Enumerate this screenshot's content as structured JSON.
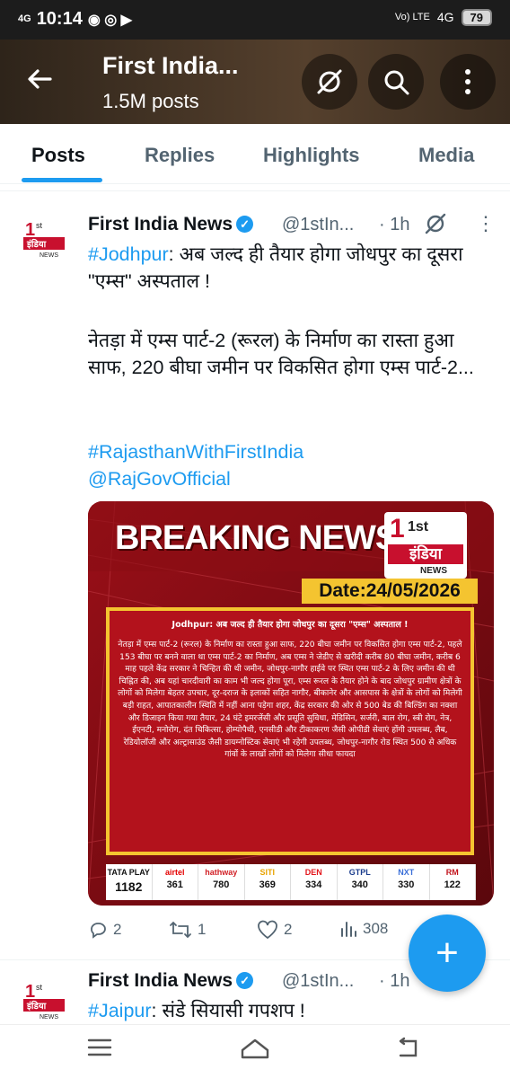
{
  "status_bar": {
    "net_left": "4G",
    "time": "10:14",
    "volte": "Vo) LTE",
    "net_right": "4G",
    "battery": "79"
  },
  "appbar": {
    "title": "First India...",
    "subtitle": "1.5M posts"
  },
  "tabs": [
    "Posts",
    "Replies",
    "Highlights",
    "Media"
  ],
  "post1": {
    "name": "First India News",
    "handle": "@1stIn...",
    "time": "· 1h",
    "line1_tag": "#Jodhpur",
    "line1_rest": ": अब जल्द ही तैयार होगा जोधपुर का दूसरा \"एम्स\" अस्पताल !",
    "para2": "नेतड़ा में एम्स पार्ट-2 (रूरल) के निर्माण का रास्ता हुआ साफ, 220 बीघा जमीन पर विकसित होगा एम्स पार्ट-2...",
    "hashtag": "#RajasthanWithFirstIndia",
    "mention": "@RajGovOfficial",
    "image": {
      "banner": "BREAKING NEWS",
      "logo_top": "1st",
      "logo_main": "इंडिया",
      "logo_sub": "NEWS",
      "date": "Date:24/05/2026",
      "headline": "Jodhpur: अब जल्द ही तैयार होगा जोधपुर का दूसरा \"एम्स\" अस्पताल !",
      "body": "नेतड़ा में एम्स पार्ट-2 (रूरल) के निर्माण का रास्ता हुआ साफ, 220 बीघा जमीन पर विकसित होगा एम्स पार्ट-2, पहले 153 बीघा पर बनने वाला था एम्स पार्ट-2 का निर्माण, अब एम्स ने जेडीए से खरीदी करीब 80 बीघा जमीन, करीब 6 माह पहले केंद्र सरकार ने चिन्हित की थी जमीन, जोधपुर-नागौर हाईवे पर स्थित एम्स पार्ट-2 के लिए जमीन की थी चिह्नित की, अब यहां चारदीवारी का काम भी जल्द होगा पूरा, एम्स रूरल के तैयार होने के बाद जोधपुर ग्रामीण क्षेत्रों के लोगों को मिलेगा बेहतर उपचार, दूर-दराज के इलाकों सहित नागौर, बीकानेर और आसपास के क्षेत्रों के लोगों को मिलेगी बड़ी राहत, आपातकालीन स्थिति में नहीं आना पड़ेगा शहर, केंद्र सरकार की ओर से 500 बेड की बिल्डिंग का नक्शा और डिजाइन किया गया तैयार, 24 घंटे इमरजेंसी और प्रसूति सुविधा, मेडिसिन, सर्जरी, बाल रोग, स्त्री रोग, नेत्र, ईएनटी, मनोरोग, दंत चिकित्सा, होम्योपैथी, एनसीडी और टीकाकरण जैसी ओपीडी सेवाएं होंगी उपलब्ध, लैब, रेडियोलॉजी और अल्ट्रासाउंड जैसी डायग्नोस्टिक सेवाएं भी रहेगी उपलब्ध, जोधपुर-नागौर रोड स्थित 500 से अधिक गांवों के लाखों लोगों को मिलेगा सीधा फायदा",
      "channels": [
        {
          "name": "TATA PLAY",
          "num": "1182",
          "color": "#111111"
        },
        {
          "name": "airtel",
          "num": "361",
          "color": "#e40000"
        },
        {
          "name": "hathway",
          "num": "780",
          "color": "#d11e24"
        },
        {
          "name": "SITI",
          "num": "369",
          "color": "#e8a300"
        },
        {
          "name": "DEN",
          "num": "334",
          "color": "#e3161c"
        },
        {
          "name": "GTPL",
          "num": "340",
          "color": "#1a3c8c"
        },
        {
          "name": "NXT",
          "num": "330",
          "color": "#3a6fd8"
        },
        {
          "name": "RM",
          "num": "122",
          "color": "#c2121a"
        }
      ]
    },
    "actions": {
      "replies": "2",
      "reposts": "1",
      "likes": "2",
      "views": "308"
    }
  },
  "post2": {
    "name": "First India News",
    "handle": "@1stIn...",
    "time": "· 1h",
    "tag": "#Jaipur",
    "rest": ": संडे सियासी गपशप !"
  },
  "colors": {
    "accent": "#1d9bf0",
    "breaking_red": "#7a0c12",
    "date_yellow": "#f4c430"
  },
  "icons": [
    "back-arrow-icon",
    "grok-icon",
    "search-icon",
    "more-vertical-icon",
    "reply-icon",
    "repost-icon",
    "like-icon",
    "views-icon",
    "compose-plus-icon",
    "menu-icon",
    "home-icon",
    "back-nav-icon"
  ]
}
